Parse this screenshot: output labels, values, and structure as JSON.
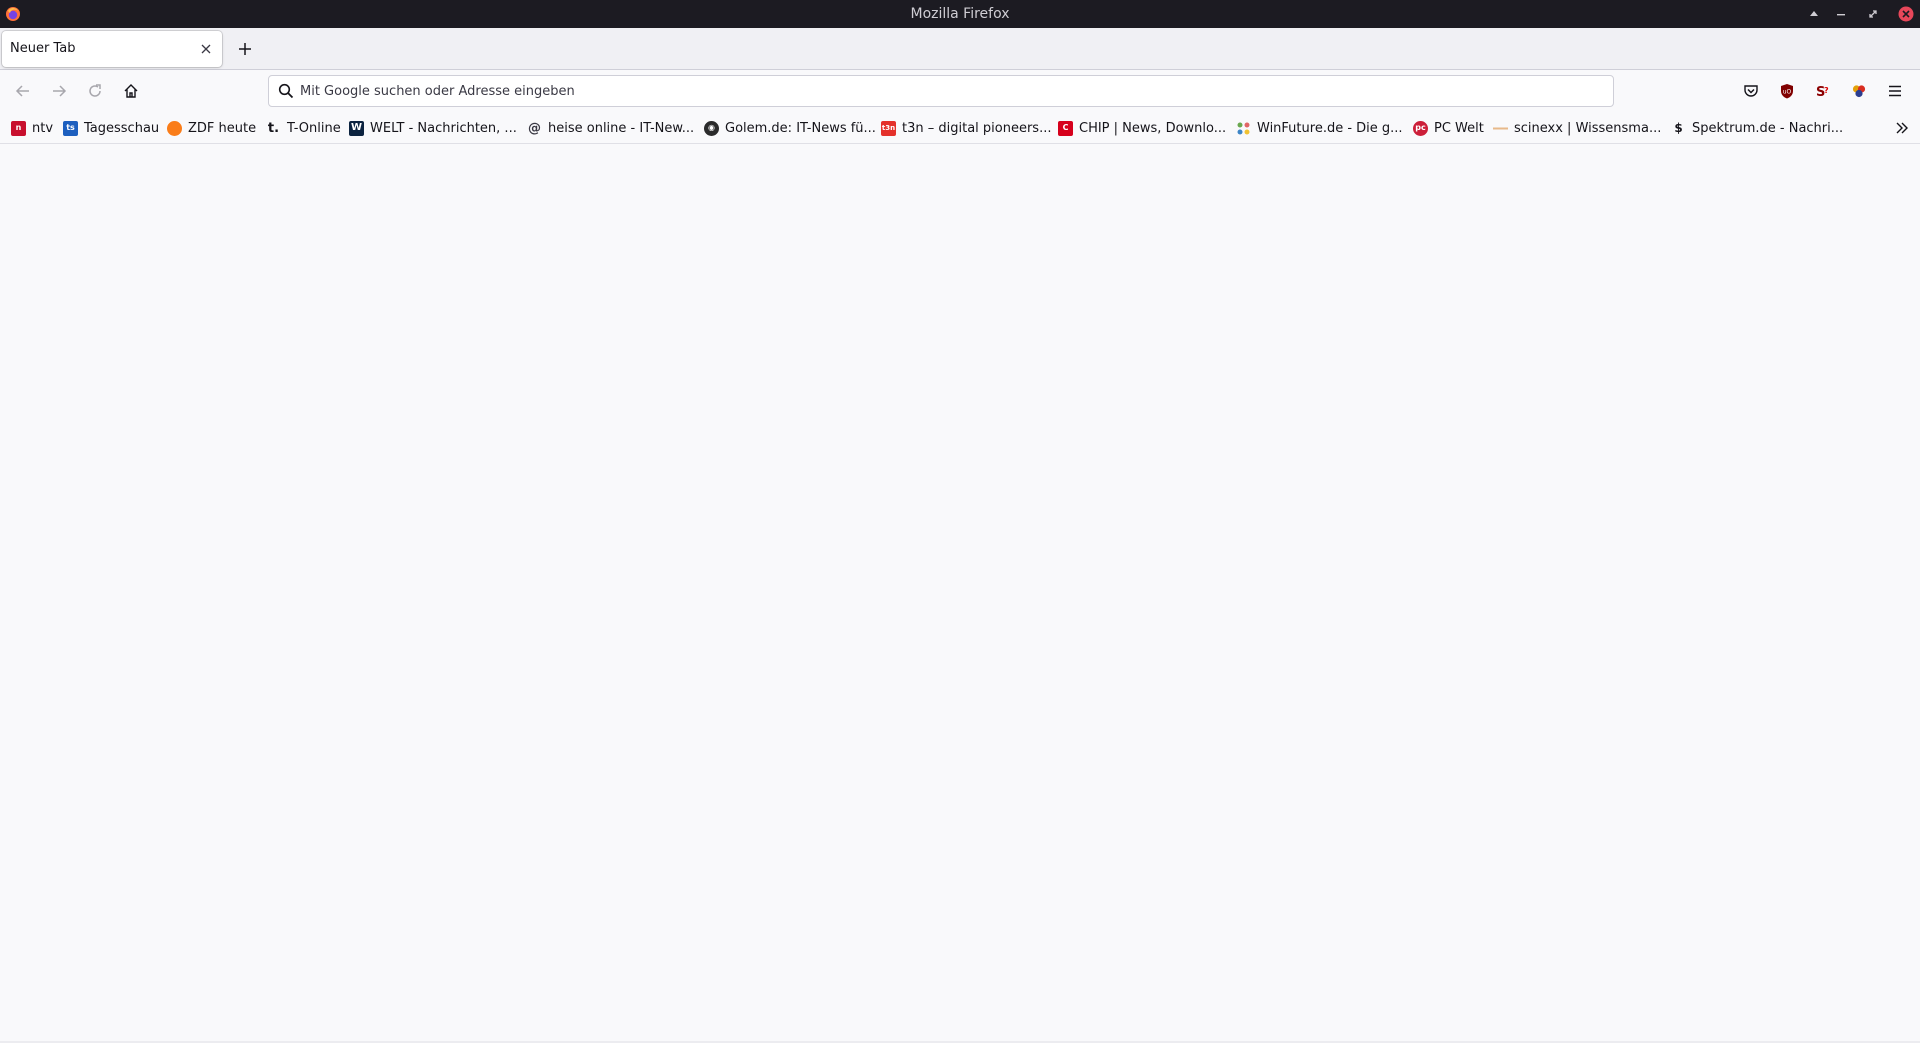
{
  "window": {
    "title": "Mozilla Firefox"
  },
  "tabs": [
    {
      "label": "Neuer Tab"
    }
  ],
  "urlbar": {
    "placeholder": "Mit Google suchen oder Adresse eingeben"
  },
  "toolbar_icons": [
    "pocket-icon",
    "ublock-icon",
    "extension-icon",
    "multi-account-icon",
    "menu-icon"
  ],
  "bookmarks": [
    {
      "label": "ntv",
      "icon": "ntv-icon",
      "color": "#c8102e"
    },
    {
      "label": "Tagesschau",
      "icon": "tagesschau-icon",
      "color": "#1d5fbf"
    },
    {
      "label": "ZDF heute",
      "icon": "zdf-icon",
      "color": "#fa7d19"
    },
    {
      "label": "T-Online",
      "icon": "t-online-icon",
      "color": "#15141a"
    },
    {
      "label": "WELT - Nachrichten, ...",
      "icon": "welt-icon",
      "color": "#0c2340"
    },
    {
      "label": "heise online - IT-New...",
      "icon": "heise-icon",
      "color": "#3a3944"
    },
    {
      "label": "Golem.de: IT-News fü...",
      "icon": "golem-icon",
      "color": "#2b2b2b"
    },
    {
      "label": "t3n – digital pioneers...",
      "icon": "t3n-icon",
      "color": "#e4312b"
    },
    {
      "label": "CHIP | News, Downlo...",
      "icon": "chip-icon",
      "color": "#d6001c"
    },
    {
      "label": "WinFuture.de - Die g...",
      "icon": "winfuture-icon",
      "color": "#6aa84f"
    },
    {
      "label": "PC Welt",
      "icon": "pcwelt-icon",
      "color": "#cc1f39"
    },
    {
      "label": "scinexx | Wissensma...",
      "icon": "scinexx-icon",
      "color": "#e8b98a"
    },
    {
      "label": "Spektrum.de - Nachri...",
      "icon": "spektrum-icon",
      "color": "#15141a"
    }
  ],
  "colors": {
    "titlebar": "#1c1b22",
    "toolbar": "#f9f9fb",
    "tabstrip": "#f0f0f4"
  }
}
